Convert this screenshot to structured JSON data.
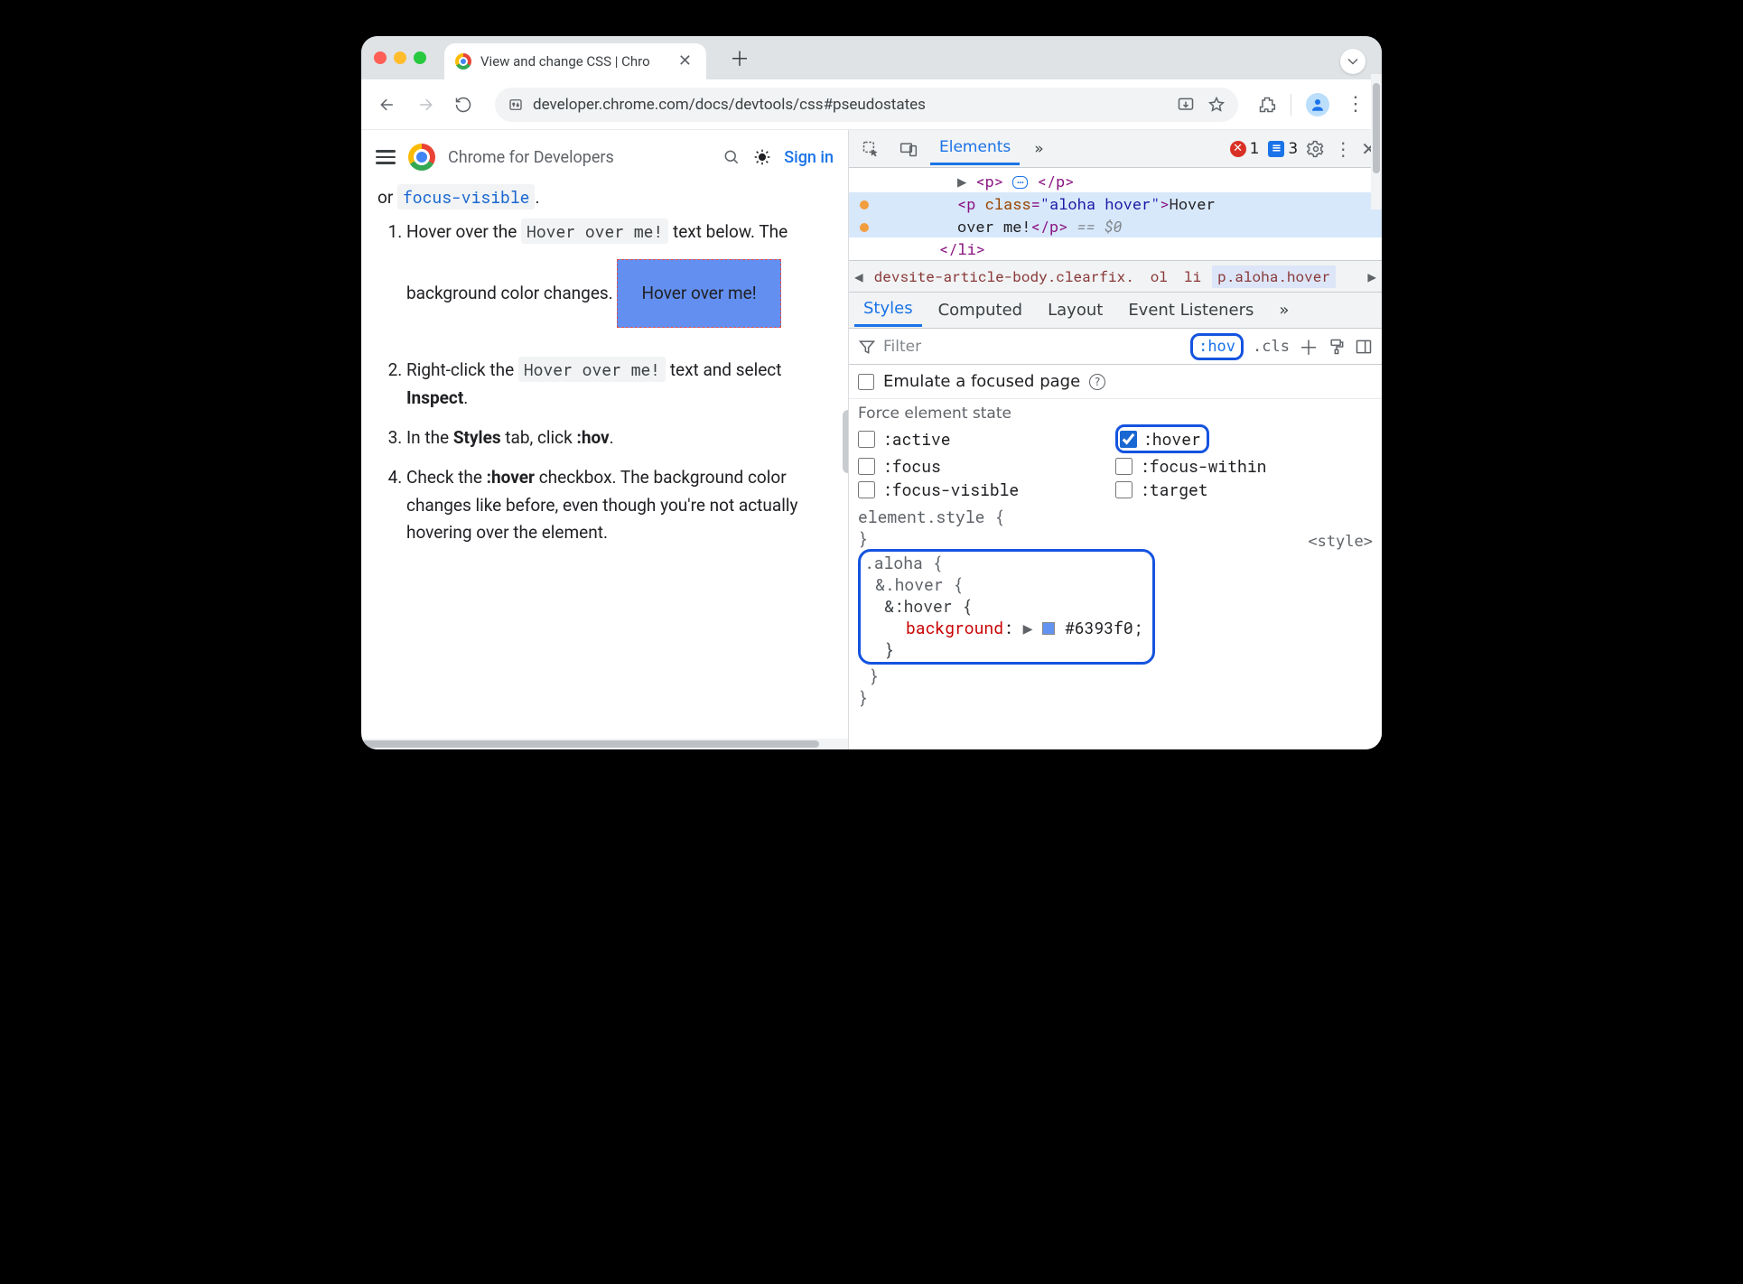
{
  "window": {
    "tab_title": "View and change CSS  |  Chro",
    "url": "developer.chrome.com/docs/devtools/css#pseudostates"
  },
  "page_header": {
    "title": "Chrome for Developers",
    "signin": "Sign in"
  },
  "article": {
    "intro_or": "or ",
    "focus_visible": "focus-visible",
    "step1_a": "Hover over the ",
    "hover_over_me_code": "Hover over me!",
    "step1_b": " text below. The background color changes.",
    "hover_box": "Hover over me!",
    "step2_a": "Right-click the ",
    "step2_b": " text and select ",
    "inspect": "Inspect",
    "step3_a": "In the ",
    "styles": "Styles",
    "step3_b": " tab, click ",
    "hov": ":hov",
    "step4_a": "Check the ",
    "hover_bold": ":hover",
    "step4_b": " checkbox. The background color changes like before, even though you're not actually hovering over the element."
  },
  "devtools": {
    "tabs": {
      "elements": "Elements",
      "more": "»"
    },
    "errors": "1",
    "messages": "3",
    "dom": {
      "l1_open": "<p>",
      "l1_close": "</p>",
      "l2_open": "<p ",
      "l2_class_attr": "class",
      "l2_class_val": "\"aloha hover\"",
      "l2_text": "Hover",
      "l3_text": "over me!",
      "l3_close": "</p>",
      "l3_eq": "== $0",
      "l4": "</li>"
    },
    "breadcrumbs": {
      "b1": "devsite-article-body.clearfix.",
      "b2": "ol",
      "b3": "li",
      "b4": "p.aloha.hover"
    },
    "styles_tabs": {
      "styles": "Styles",
      "computed": "Computed",
      "layout": "Layout",
      "events": "Event Listeners",
      "more": "»"
    },
    "filter": {
      "label": "Filter",
      "hov": ":hov",
      "cls": ".cls"
    },
    "emulate": "Emulate a focused page",
    "force_title": "Force element state",
    "pseudos": {
      "active": ":active",
      "hover": ":hover",
      "focus": ":focus",
      "focus_within": ":focus-within",
      "focus_visible": ":focus-visible",
      "target": ":target"
    },
    "css": {
      "elstyle": "element.style {",
      "close": "}",
      "aloha": ".aloha {",
      "and_hover": "&.hover {",
      "and_hover_pseudo": "&:hover {",
      "prop": "background",
      "val": "#6393f0",
      "source": "<style>"
    }
  }
}
